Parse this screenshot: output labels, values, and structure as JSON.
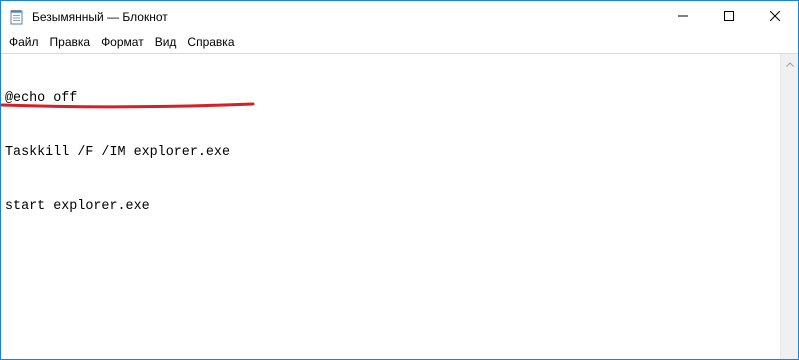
{
  "window": {
    "title": "Безымянный — Блокнот",
    "icon": "notepad-icon",
    "controls": [
      "minimize-icon",
      "maximize-icon",
      "close-icon"
    ]
  },
  "menu": {
    "items": [
      {
        "label": "Файл"
      },
      {
        "label": "Правка"
      },
      {
        "label": "Формат"
      },
      {
        "label": "Вид"
      },
      {
        "label": "Справка"
      }
    ]
  },
  "editor": {
    "lines": [
      "@echo off",
      "Taskkill /F /IM explorer.exe",
      "start explorer.exe"
    ],
    "highlight_color": "#d61f26"
  },
  "colors": {
    "window_border": "#1883d7",
    "annotation": "#d61f26"
  }
}
